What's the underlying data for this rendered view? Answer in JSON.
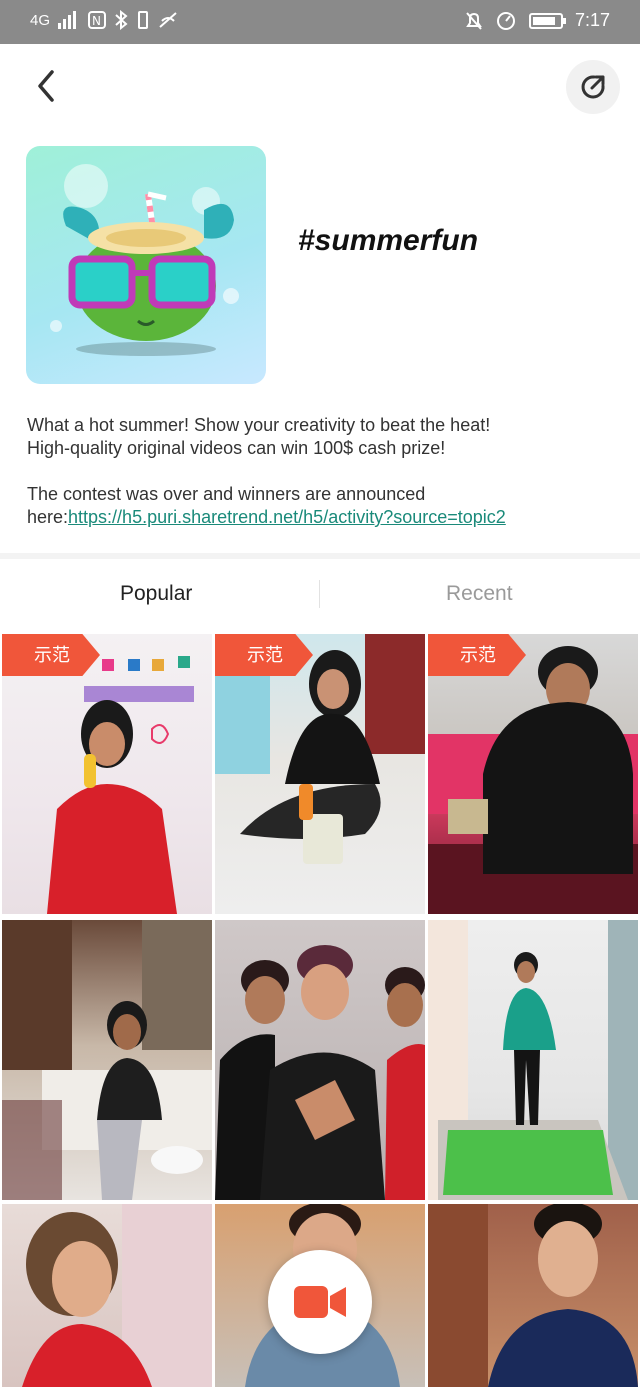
{
  "status_bar": {
    "signal": "4G",
    "time": "7:17"
  },
  "header": {
    "back_icon": "chevron-left-icon",
    "share_icon": "share-arrow-icon"
  },
  "topic": {
    "title": "#summerfun",
    "description_line1": "What a hot summer! Show your creativity to beat the heat!",
    "description_line2": "High-quality original videos can win 100$ cash prize!",
    "notice_line1": "The contest was over and winners are announced",
    "notice_prefix": "here:",
    "notice_link": "https://h5.puri.sharetrend.net/h5/activity?source=topic2"
  },
  "tabs": {
    "popular": "Popular",
    "recent": "Recent"
  },
  "grid": {
    "badge_label": "示范",
    "tiles": [
      "tile-1",
      "tile-2",
      "tile-3",
      "tile-4",
      "tile-5",
      "tile-6",
      "tile-7",
      "tile-8",
      "tile-9"
    ]
  },
  "colors": {
    "accent_badge": "#f0563a",
    "link": "#1a8a7a",
    "record_icon": "#f0563a"
  },
  "record_button_icon": "video-camera-icon"
}
